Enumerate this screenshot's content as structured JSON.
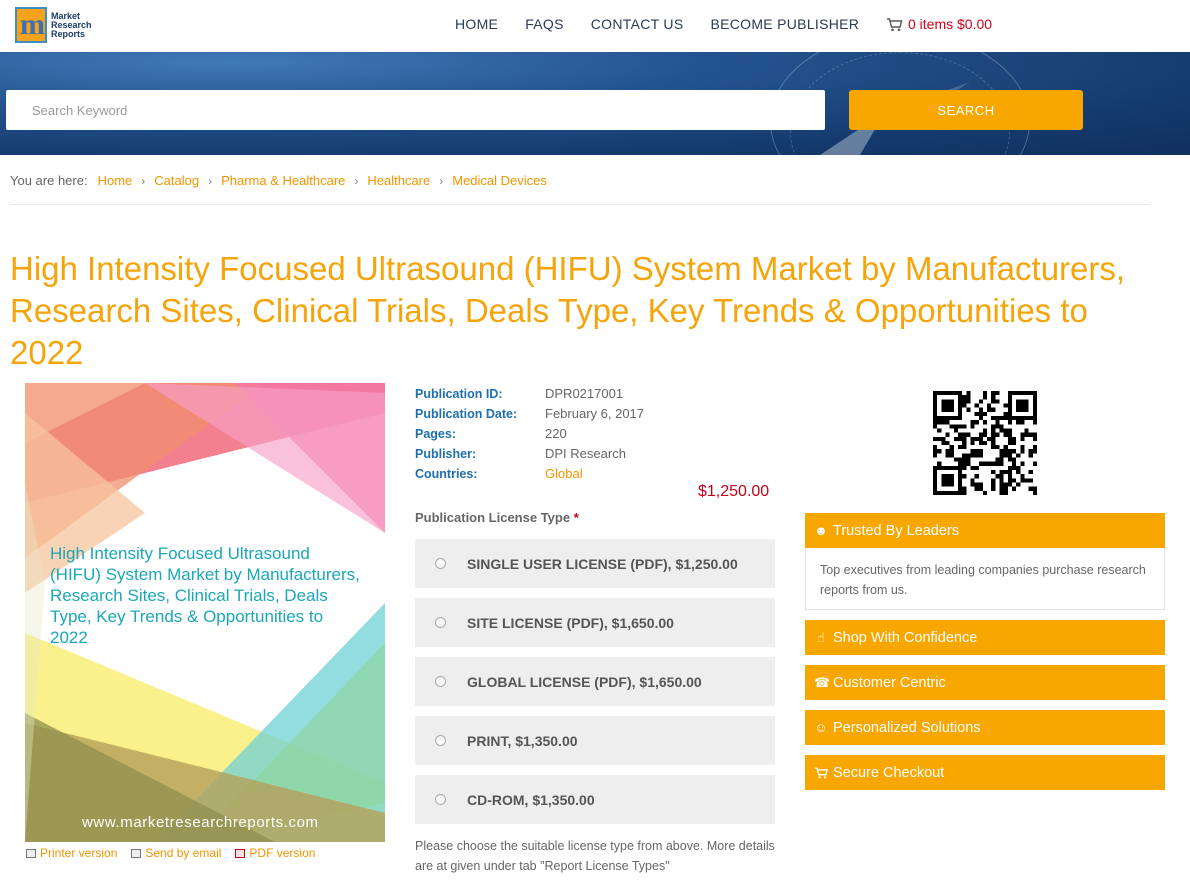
{
  "header": {
    "logo_text": [
      "Market",
      "Research",
      "Reports"
    ],
    "logo_letter": "m",
    "nav": [
      "HOME",
      "FAQS",
      "CONTACT US",
      "BECOME PUBLISHER"
    ],
    "cart": "0 items $0.00"
  },
  "search": {
    "placeholder": "Search Keyword",
    "button": "SEARCH"
  },
  "breadcrumb": {
    "lead": "You are here:",
    "items": [
      "Home",
      "Catalog",
      "Pharma & Healthcare",
      "Healthcare",
      "Medical Devices"
    ]
  },
  "page_title": "High Intensity Focused Ultrasound (HIFU) System Market by Manufacturers, Research Sites, Clinical Trials, Deals Type, Key Trends & Opportunities to 2022",
  "cover": {
    "title": "High Intensity Focused Ultrasound (HIFU) System Market by Manufacturers, Research Sites, Clinical Trials, Deals Type, Key Trends & Opportunities to 2022",
    "url": "www.marketresearchreports.com"
  },
  "tools": [
    "Printer version",
    "Send by email",
    "PDF version"
  ],
  "meta": [
    {
      "key": "Publication ID:",
      "value": "DPR0217001"
    },
    {
      "key": "Publication Date:",
      "value": "February 6, 2017"
    },
    {
      "key": "Pages:",
      "value": "220"
    },
    {
      "key": "Publisher:",
      "value": "DPI Research"
    },
    {
      "key": "Countries:",
      "value": "Global"
    }
  ],
  "price": "$1,250.00",
  "license": {
    "label": "Publication License Type",
    "required_mark": "*",
    "options": [
      "SINGLE USER LICENSE (PDF), $1,250.00",
      "SITE LICENSE (PDF), $1,650.00",
      "GLOBAL LICENSE (PDF), $1,650.00",
      "PRINT, $1,350.00",
      "CD-ROM, $1,350.00"
    ],
    "note": "Please choose the suitable license type from above. More details are at given under tab \"Report License Types\""
  },
  "panels": {
    "trusted": "Trusted By Leaders",
    "trusted_body": "Top executives from leading companies purchase research reports from us.",
    "confidence": "Shop With Confidence",
    "centric": "Customer Centric",
    "personalized": "Personalized Solutions",
    "checkout": "Secure Checkout"
  },
  "colors": {
    "accent": "#f8a600",
    "title": "#f5a50b",
    "link": "#f29400",
    "meta_key": "#1f6fae",
    "price": "#c4001a",
    "banner": "#1b4479"
  }
}
